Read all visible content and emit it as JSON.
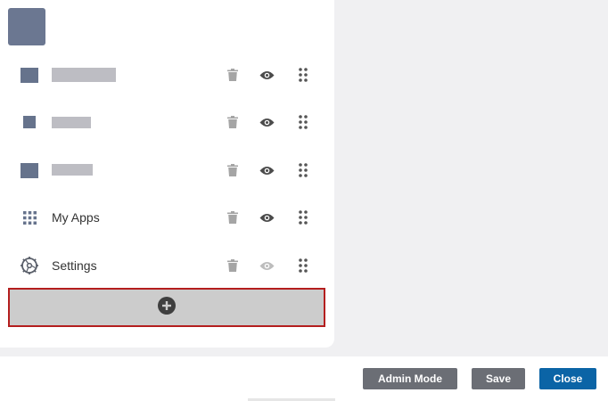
{
  "panel": {
    "items": [
      {
        "label": "",
        "icon": "tile-icon",
        "visibility": "visible"
      },
      {
        "label": "",
        "icon": "tile-icon",
        "visibility": "visible"
      },
      {
        "label": "",
        "icon": "tile-icon",
        "visibility": "visible"
      },
      {
        "label": "My Apps",
        "icon": "grid-icon",
        "visibility": "visible"
      },
      {
        "label": "Settings",
        "icon": "settings-icon",
        "visibility": "dimmed"
      }
    ],
    "add_icon": "plus-circle-icon"
  },
  "footer": {
    "admin_mode_label": "Admin Mode",
    "save_label": "Save",
    "close_label": "Close"
  },
  "colors": {
    "add_border": "#b41e1e",
    "close_button": "#0b64a6",
    "secondary_button": "#6b6e75",
    "tile_icon": "#66738c"
  }
}
